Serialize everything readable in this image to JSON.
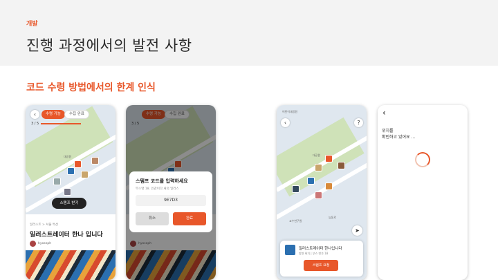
{
  "header": {
    "tag": "개발",
    "title": "진행 과정에서의 발전 사항"
  },
  "section_title": "코드 수령 방법에서의 한계 인식",
  "screen1": {
    "tab_available": "수령 가능",
    "tab_done": "수집 완료",
    "progress": "3 / 5",
    "map_label": "대공원",
    "stamp_button": "스탬프 받기",
    "crumb": "일러스트 > 서울 특산",
    "card_title": "일러스트레이터 한나 입니다",
    "author": "hyoseph"
  },
  "screen2": {
    "tab_available": "수령 가능",
    "tab_done": "수집 완료",
    "progress": "3 / 5",
    "modal_title": "스탬프 코드를 입력하세요",
    "modal_sub": "부스명 18. 인감이다 새의 일러스",
    "code": "9E7D3",
    "cancel": "취소",
    "confirm": "완료",
    "author": "hyoseph"
  },
  "screen3": {
    "top_label": "어린이대공원",
    "park_label": "대공원",
    "street_label_1": "교수연구원",
    "street_label_2": "능동로",
    "card_title": "일러스트레이터 한나입니다",
    "card_meta": "방향 위치 | 부스 번호 18",
    "stamp_button": "스탬프 요청"
  },
  "screen4": {
    "back": "‹",
    "wait_text": "위치를\n확인하고 있어요 ..."
  }
}
